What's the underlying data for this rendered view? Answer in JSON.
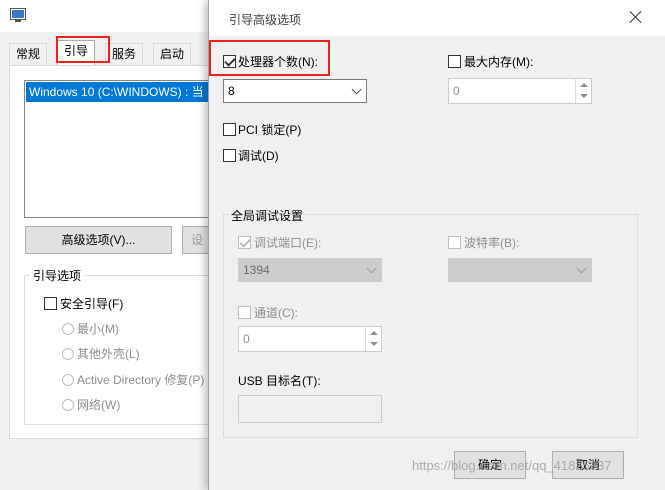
{
  "bg_window": {
    "tabs": [
      {
        "label": "常规"
      },
      {
        "label": "引导"
      },
      {
        "label": "服务"
      },
      {
        "label": "启动"
      }
    ],
    "os_list_item": "Windows 10 (C:\\WINDOWS) : 当",
    "advanced_button_label": "高级选项(V)...",
    "second_button_label": "设",
    "boot_options": {
      "group_label": "引导选项",
      "safe_boot_label": "安全引导(F)",
      "radios": [
        "最小(M)",
        "其他外壳(L)",
        "Active Directory 修复(P)",
        "网络(W)"
      ]
    }
  },
  "dialog": {
    "title": "引导高级选项",
    "num_processors": {
      "label": "处理器个数(N):",
      "checked": true,
      "value": "8"
    },
    "max_memory": {
      "label": "最大内存(M):",
      "checked": false,
      "value": "0"
    },
    "pci_lock_label": "PCI 锁定(P)",
    "debug_label": "调试(D)",
    "global_debug": {
      "group_label": "全局调试设置",
      "debug_port": {
        "label": "调试端口(E):",
        "checked": true,
        "value": "1394"
      },
      "baud_rate": {
        "label": "波特率(B):",
        "checked": false,
        "value": ""
      },
      "channel": {
        "label": "通道(C):",
        "checked": false,
        "value": "0"
      },
      "usb_target_label": "USB 目标名(T):",
      "usb_target_value": ""
    },
    "ok_label": "确定",
    "cancel_label": "取消"
  },
  "watermark": "https://blog.csdn.net/qq_41825337",
  "colors": {
    "selection": "#0078d7",
    "highlight": "#e8231d",
    "window_bg": "#f0f0f0"
  }
}
